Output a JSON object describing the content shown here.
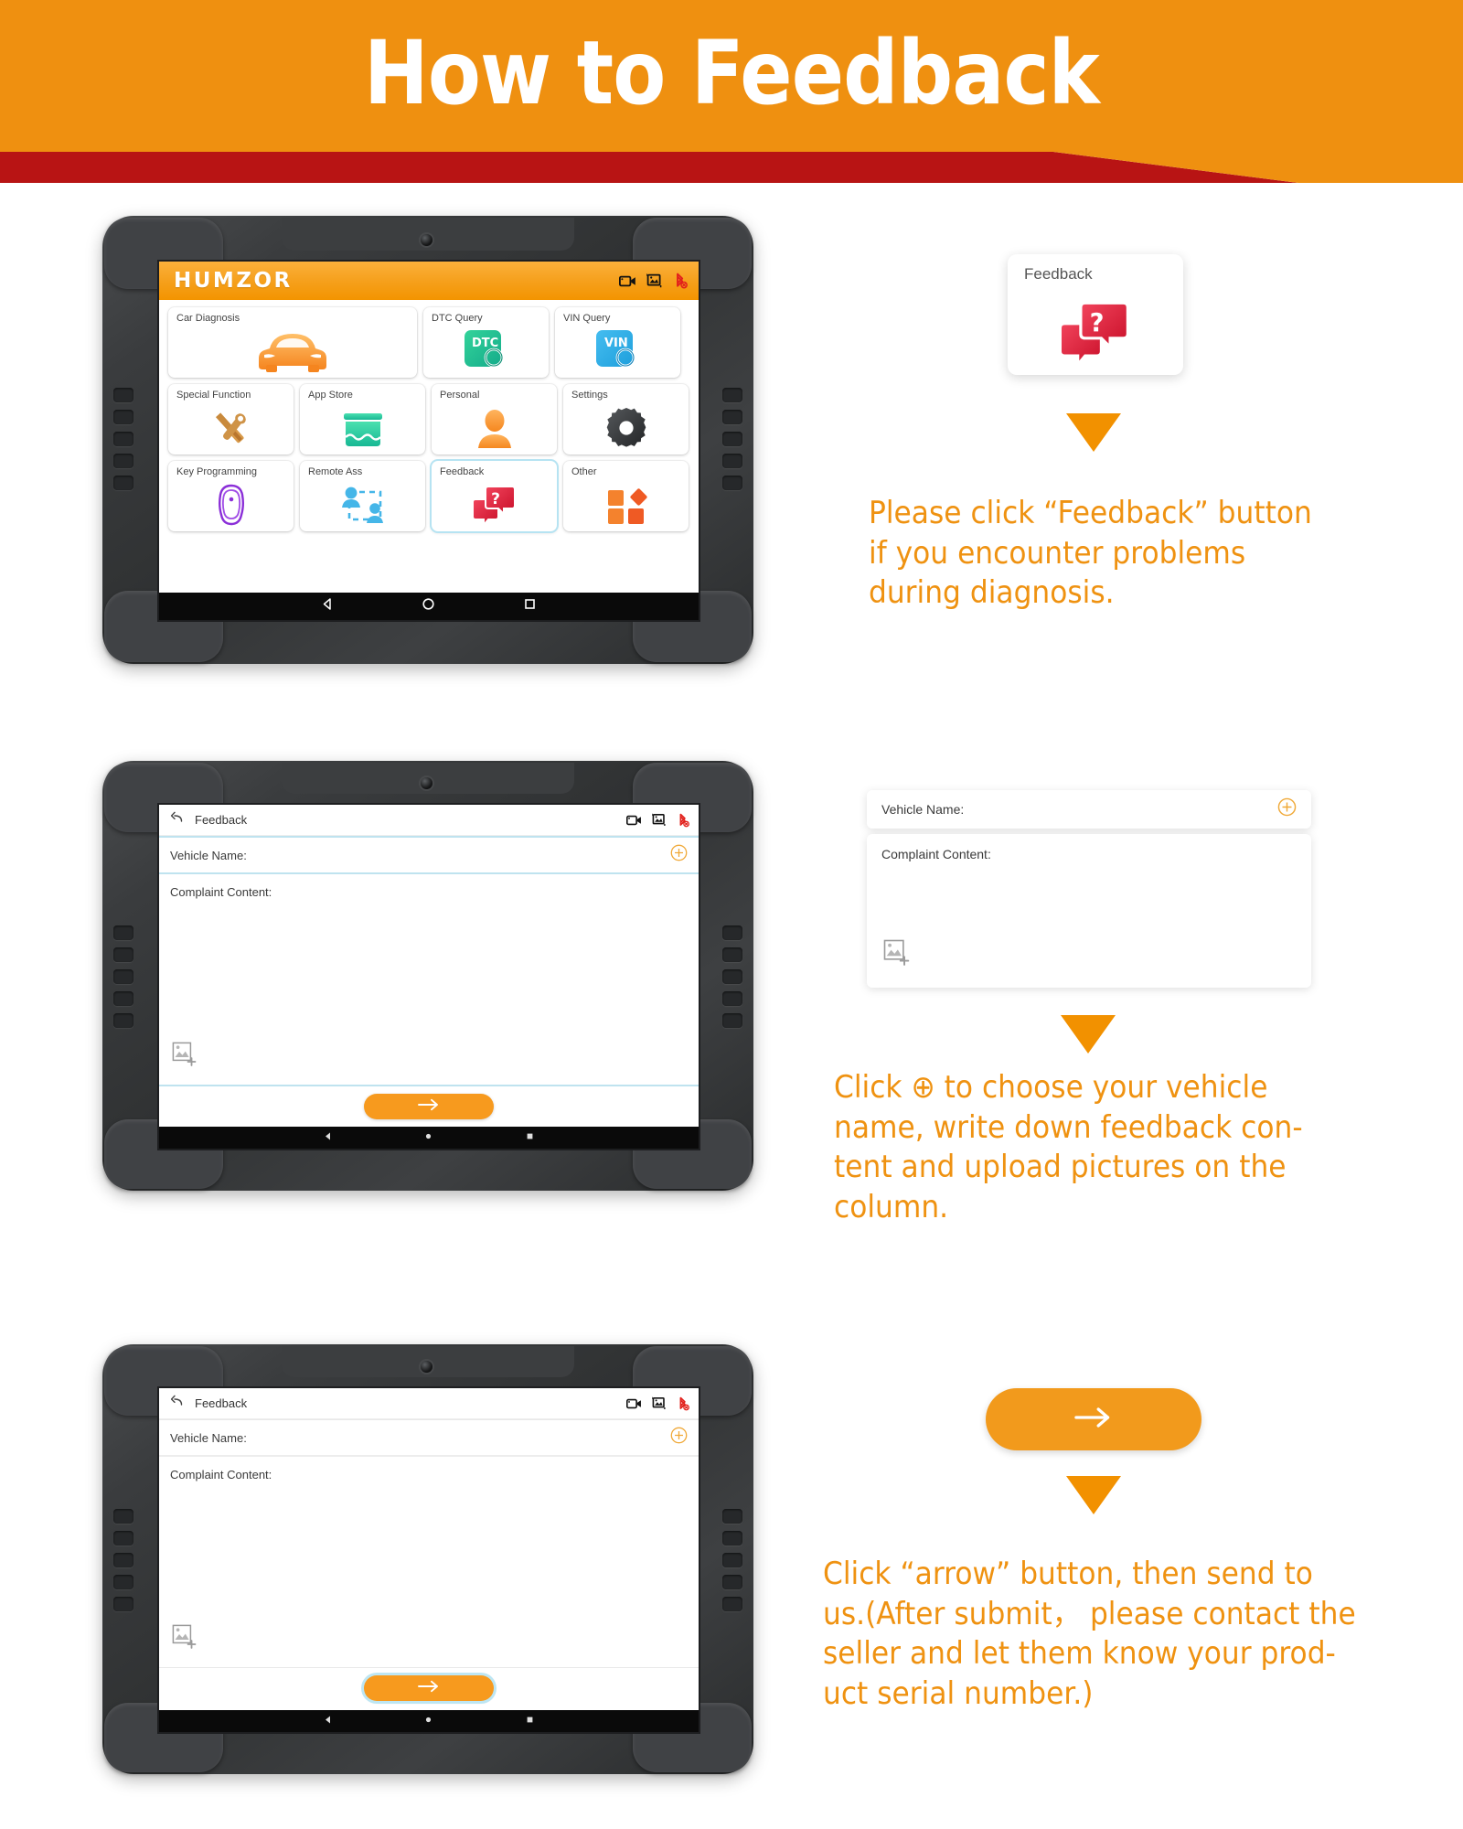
{
  "header": {
    "title": "How to Feedback",
    "band_color": "#ef9010",
    "accent_color": "#b81414"
  },
  "home_screen": {
    "brand": "HUMZOR",
    "status_icons": [
      "video-camera-icon",
      "screenshot-icon",
      "bluetooth-off-icon"
    ],
    "apps": [
      {
        "label": "Car Diagnosis",
        "icon": "car-icon",
        "wide": true,
        "highlight": false
      },
      {
        "label": "DTC Query",
        "icon": "dtc-search-icon",
        "wide": false,
        "highlight": false
      },
      {
        "label": "VIN Query",
        "icon": "vin-search-icon",
        "wide": false,
        "highlight": false
      },
      {
        "label": "Special Function",
        "icon": "tools-icon",
        "wide": false,
        "highlight": false
      },
      {
        "label": "App Store",
        "icon": "store-icon",
        "wide": false,
        "highlight": false
      },
      {
        "label": "Personal",
        "icon": "user-icon",
        "wide": false,
        "highlight": false
      },
      {
        "label": "Settings",
        "icon": "gear-icon",
        "wide": false,
        "highlight": false
      },
      {
        "label": "Key Programming",
        "icon": "car-key-icon",
        "wide": false,
        "highlight": false
      },
      {
        "label": "Remote Ass",
        "icon": "remote-assistance-icon",
        "wide": false,
        "highlight": false
      },
      {
        "label": "Feedback",
        "icon": "feedback-bubbles-icon",
        "wide": false,
        "highlight": true
      },
      {
        "label": "Other",
        "icon": "other-shapes-icon",
        "wide": false,
        "highlight": false
      }
    ],
    "dtc_badge": "DTC",
    "vin_badge": "VIN",
    "navbar": [
      "back-icon",
      "home-icon",
      "recents-icon"
    ]
  },
  "feedback_form": {
    "back_icon": "back-arrow-icon",
    "title": "Feedback",
    "status_icons": [
      "video-camera-icon",
      "screenshot-icon",
      "bluetooth-off-icon"
    ],
    "vehicle_name_label": "Vehicle Name:",
    "vehicle_name_value": "",
    "add_vehicle_icon": "plus-circle-icon",
    "complaint_label": "Complaint Content:",
    "complaint_value": "",
    "upload_icon": "image-add-icon",
    "submit_icon": "arrow-right-icon"
  },
  "steps": [
    {
      "id": "step-1",
      "callout_label": "Feedback",
      "callout_icon": "feedback-bubbles-icon",
      "caption": "Please click “Feedback” button\nif you encounter problems\nduring diagnosis."
    },
    {
      "id": "step-2",
      "caption": "Click ⊕ to choose your vehicle\nname, write down feedback con-\ntent and upload pictures on the\ncolumn."
    },
    {
      "id": "step-3",
      "caption": "Click “arrow” button, then send to\nus.(After submit， please contact the\nseller and let them know your prod-\nuct serial number.)"
    }
  ],
  "colors": {
    "orange": "#ef9211",
    "amber": "#f79a1e",
    "red": "#e02b3c",
    "teal": "#25c08a",
    "blue": "#33abe0",
    "purple": "#8a2be2"
  }
}
